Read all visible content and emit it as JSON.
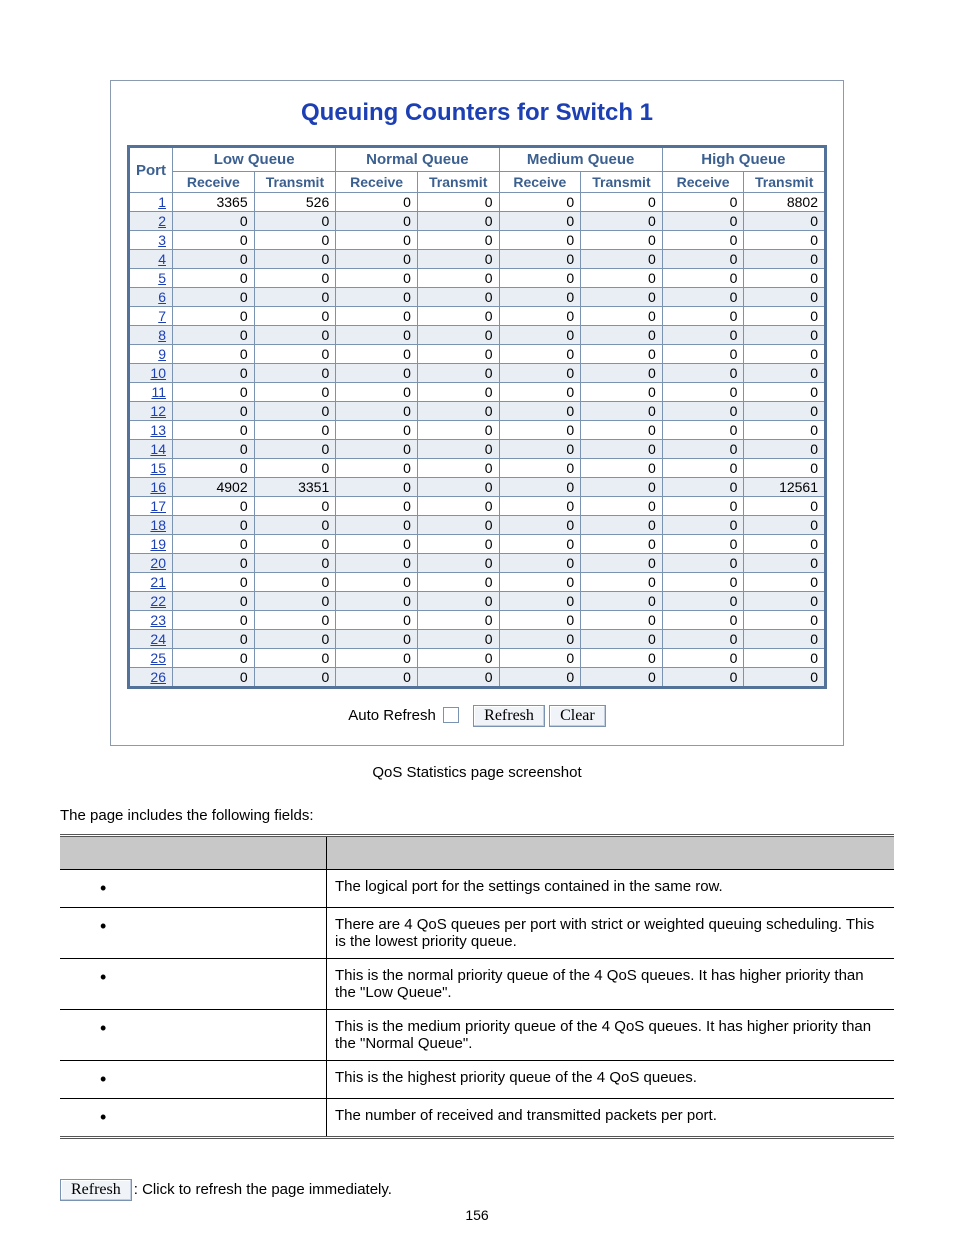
{
  "title": "Queuing Counters for Switch 1",
  "column_groups": [
    "Low Queue",
    "Normal Queue",
    "Medium Queue",
    "High Queue"
  ],
  "port_header": "Port",
  "sub_headers": [
    "Receive",
    "Transmit"
  ],
  "rows": [
    {
      "port": "1",
      "v": [
        3365,
        526,
        0,
        0,
        0,
        0,
        0,
        8802
      ]
    },
    {
      "port": "2",
      "v": [
        0,
        0,
        0,
        0,
        0,
        0,
        0,
        0
      ]
    },
    {
      "port": "3",
      "v": [
        0,
        0,
        0,
        0,
        0,
        0,
        0,
        0
      ]
    },
    {
      "port": "4",
      "v": [
        0,
        0,
        0,
        0,
        0,
        0,
        0,
        0
      ]
    },
    {
      "port": "5",
      "v": [
        0,
        0,
        0,
        0,
        0,
        0,
        0,
        0
      ]
    },
    {
      "port": "6",
      "v": [
        0,
        0,
        0,
        0,
        0,
        0,
        0,
        0
      ]
    },
    {
      "port": "7",
      "v": [
        0,
        0,
        0,
        0,
        0,
        0,
        0,
        0
      ]
    },
    {
      "port": "8",
      "v": [
        0,
        0,
        0,
        0,
        0,
        0,
        0,
        0
      ]
    },
    {
      "port": "9",
      "v": [
        0,
        0,
        0,
        0,
        0,
        0,
        0,
        0
      ]
    },
    {
      "port": "10",
      "v": [
        0,
        0,
        0,
        0,
        0,
        0,
        0,
        0
      ]
    },
    {
      "port": "11",
      "v": [
        0,
        0,
        0,
        0,
        0,
        0,
        0,
        0
      ]
    },
    {
      "port": "12",
      "v": [
        0,
        0,
        0,
        0,
        0,
        0,
        0,
        0
      ]
    },
    {
      "port": "13",
      "v": [
        0,
        0,
        0,
        0,
        0,
        0,
        0,
        0
      ]
    },
    {
      "port": "14",
      "v": [
        0,
        0,
        0,
        0,
        0,
        0,
        0,
        0
      ]
    },
    {
      "port": "15",
      "v": [
        0,
        0,
        0,
        0,
        0,
        0,
        0,
        0
      ]
    },
    {
      "port": "16",
      "v": [
        4902,
        3351,
        0,
        0,
        0,
        0,
        0,
        12561
      ]
    },
    {
      "port": "17",
      "v": [
        0,
        0,
        0,
        0,
        0,
        0,
        0,
        0
      ]
    },
    {
      "port": "18",
      "v": [
        0,
        0,
        0,
        0,
        0,
        0,
        0,
        0
      ]
    },
    {
      "port": "19",
      "v": [
        0,
        0,
        0,
        0,
        0,
        0,
        0,
        0
      ]
    },
    {
      "port": "20",
      "v": [
        0,
        0,
        0,
        0,
        0,
        0,
        0,
        0
      ]
    },
    {
      "port": "21",
      "v": [
        0,
        0,
        0,
        0,
        0,
        0,
        0,
        0
      ]
    },
    {
      "port": "22",
      "v": [
        0,
        0,
        0,
        0,
        0,
        0,
        0,
        0
      ]
    },
    {
      "port": "23",
      "v": [
        0,
        0,
        0,
        0,
        0,
        0,
        0,
        0
      ]
    },
    {
      "port": "24",
      "v": [
        0,
        0,
        0,
        0,
        0,
        0,
        0,
        0
      ]
    },
    {
      "port": "25",
      "v": [
        0,
        0,
        0,
        0,
        0,
        0,
        0,
        0
      ]
    },
    {
      "port": "26",
      "v": [
        0,
        0,
        0,
        0,
        0,
        0,
        0,
        0
      ]
    }
  ],
  "controls": {
    "auto_refresh_label": "Auto Refresh",
    "refresh_label": "Refresh",
    "clear_label": "Clear"
  },
  "caption": "QoS Statistics page screenshot",
  "intro": "The page includes the following fields:",
  "fields": [
    "The logical port for the settings contained in the same row.",
    "There are 4 QoS queues per port with strict or weighted queuing scheduling. This is the lowest priority queue.",
    "This is the normal priority queue of the 4 QoS queues. It has higher priority than the \"Low Queue\".",
    "This is the medium priority queue of the 4 QoS queues. It has higher priority than the \"Normal Queue\".",
    "This is the highest priority queue of the 4 QoS queues.",
    "The number of received and transmitted packets per port."
  ],
  "after": {
    "button": "Refresh",
    "text": ": Click to refresh the page immediately."
  },
  "page_number": "156"
}
